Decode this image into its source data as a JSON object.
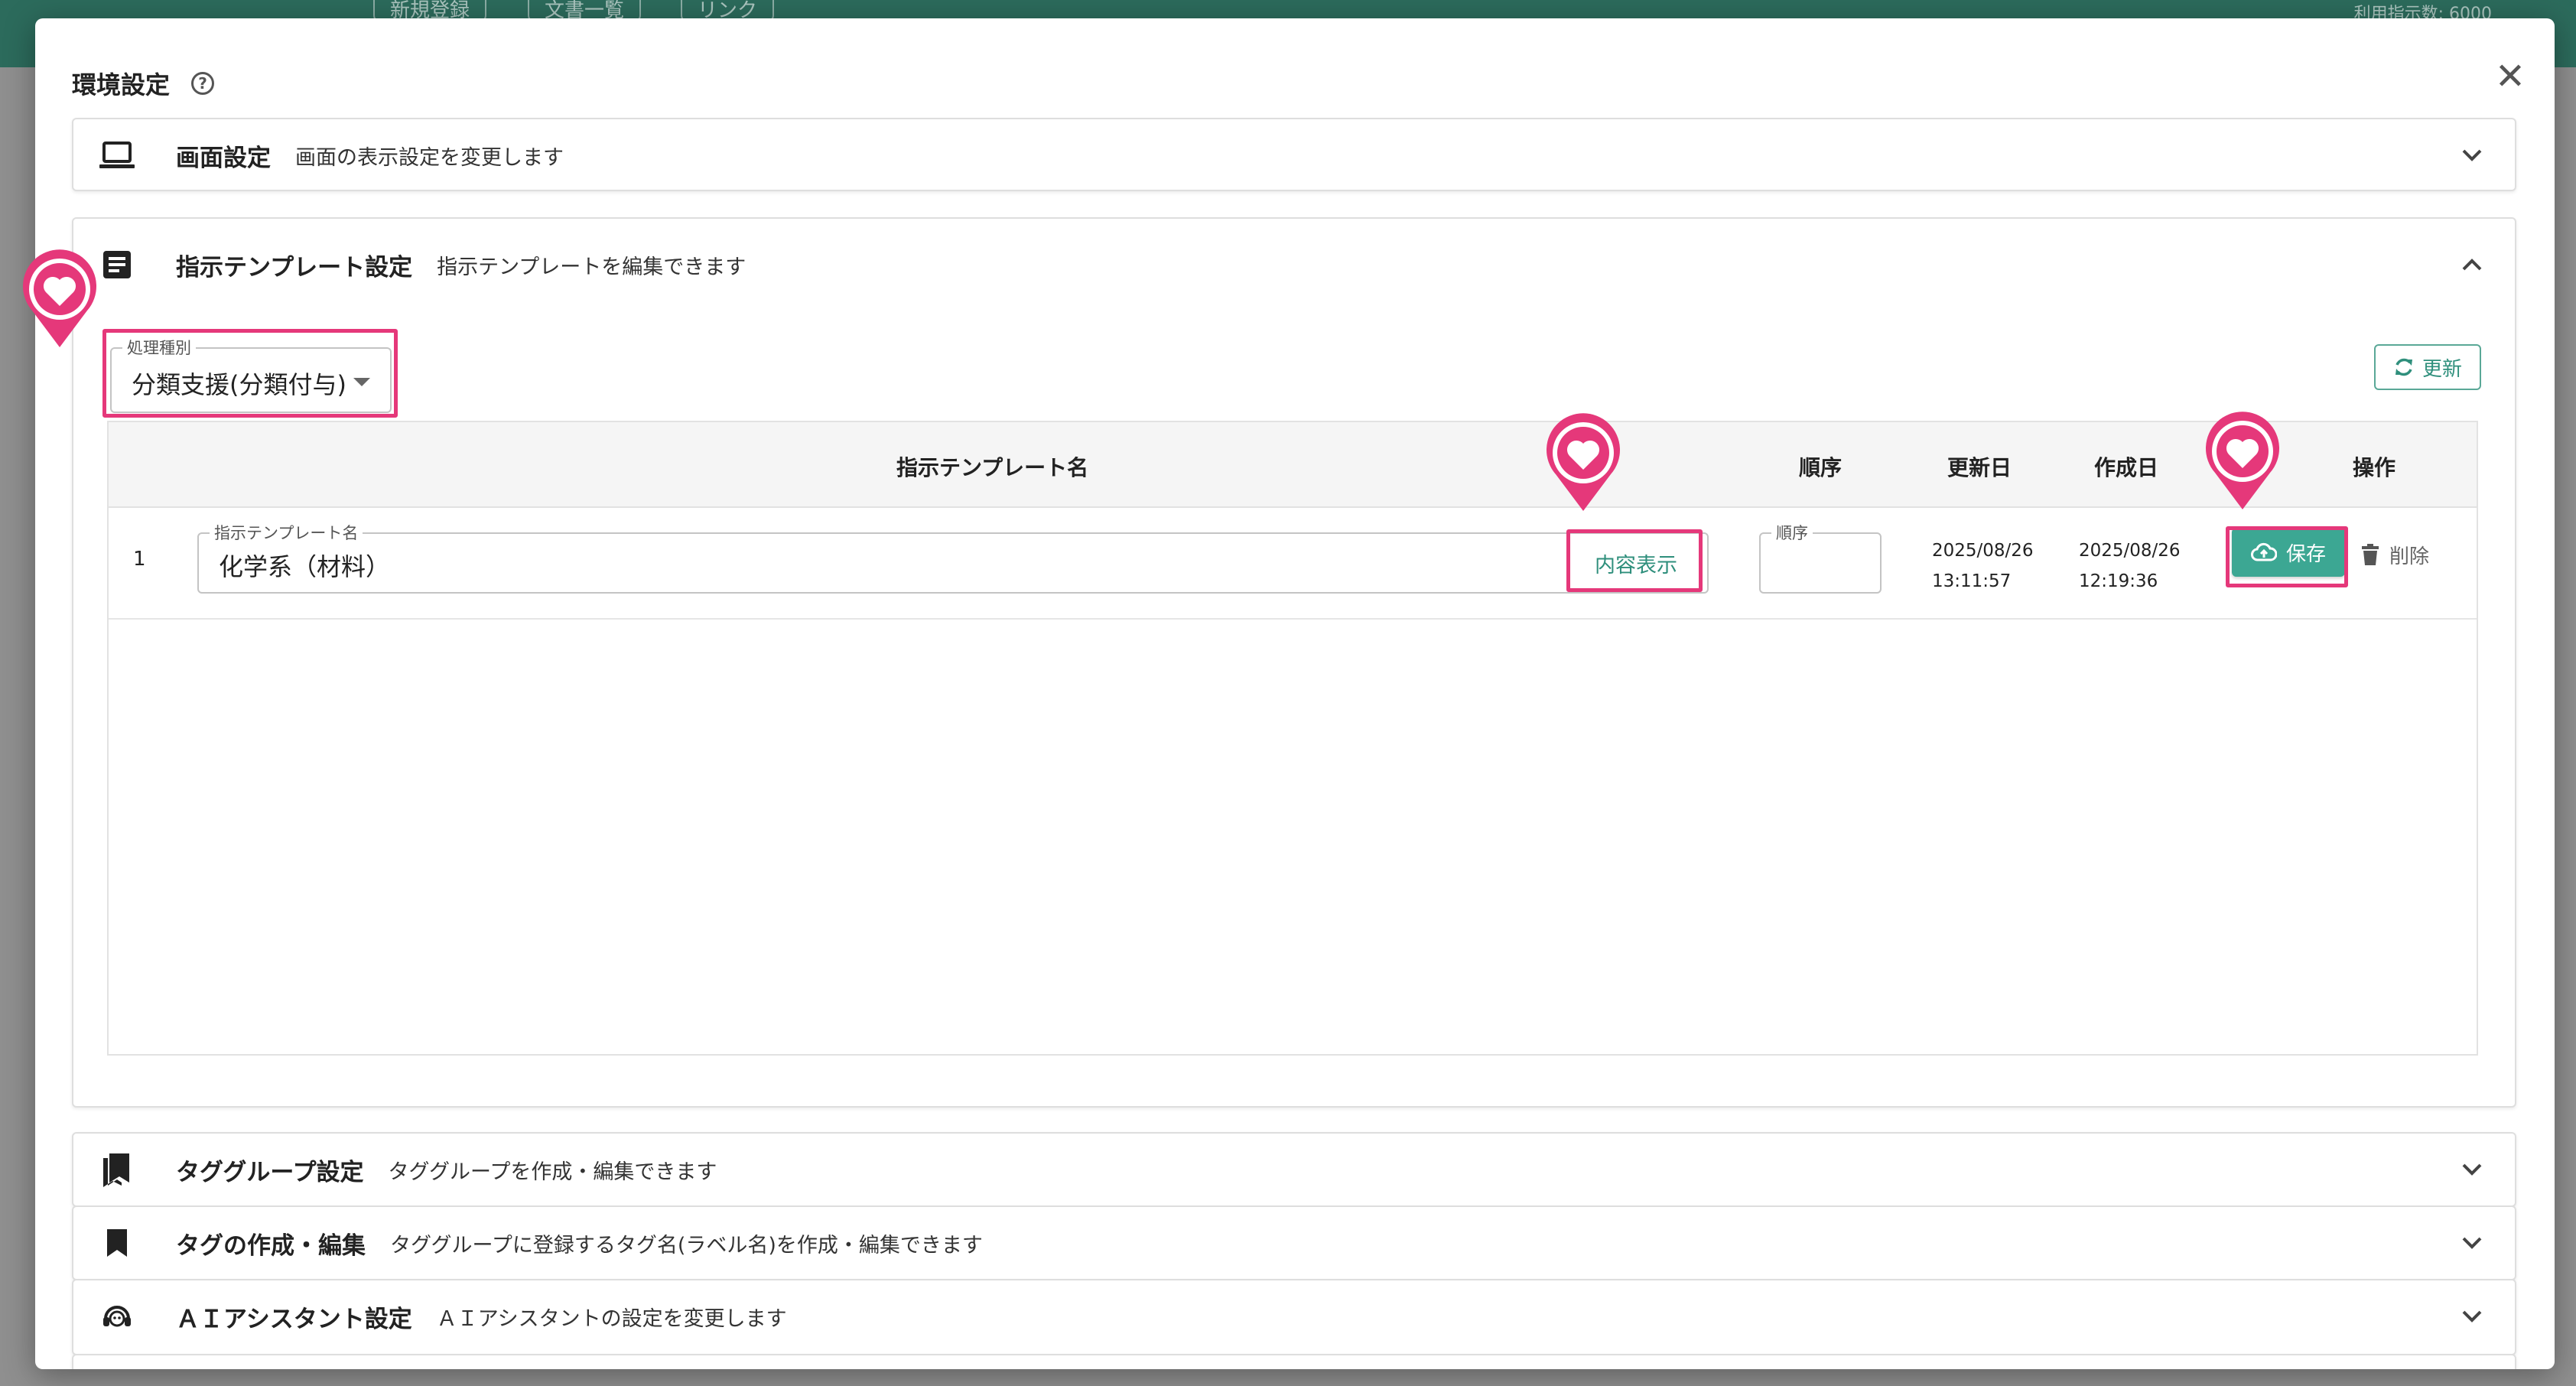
{
  "appbar": {
    "buttons": [
      "新規登録",
      "文書一覧",
      "リンク"
    ],
    "count_text": "利用指示数: 6000"
  },
  "dialog": {
    "title": "環境設定",
    "help_icon": "help-circle-icon",
    "close_icon": "close-icon"
  },
  "panels": {
    "display": {
      "title": "画面設定",
      "desc": "画面の表示設定を変更します",
      "icon": "laptop-icon"
    },
    "template": {
      "title": "指示テンプレート設定",
      "desc": "指示テンプレートを編集できます",
      "icon": "document-icon"
    },
    "tag_group": {
      "title": "タググループ設定",
      "desc": "タググループを作成・編集できます",
      "icon": "bookmarks-icon"
    },
    "tag_create": {
      "title": "タグの作成・編集",
      "desc": "タググループに登録するタグ名(ラベル名)を作成・編集できます",
      "icon": "bookmark-icon"
    },
    "ai": {
      "title": "ＡＩアシスタント設定",
      "desc": "ＡＩアシスタントの設定を変更します",
      "icon": "support-agent-icon"
    }
  },
  "template_settings": {
    "select_label": "処理種別",
    "select_value": "分類支援(分類付与)",
    "refresh_label": "更新",
    "columns": {
      "name": "指示テンプレート名",
      "order": "順序",
      "updated": "更新日",
      "created": "作成日",
      "actions": "操作"
    },
    "rows": [
      {
        "index": "1",
        "name_label": "指示テンプレート名",
        "name_value": "化学系（材料）",
        "view_label": "内容表示",
        "order_label": "順序",
        "order_value": "",
        "updated_date": "2025/08/26",
        "updated_time": "13:11:57",
        "created_date": "2025/08/26",
        "created_time": "12:19:36",
        "save_label": "保存",
        "delete_label": "削除"
      }
    ]
  },
  "colors": {
    "accent": "#3ca793",
    "highlight": "#e5387a",
    "appbar": "#2c6b5c"
  }
}
